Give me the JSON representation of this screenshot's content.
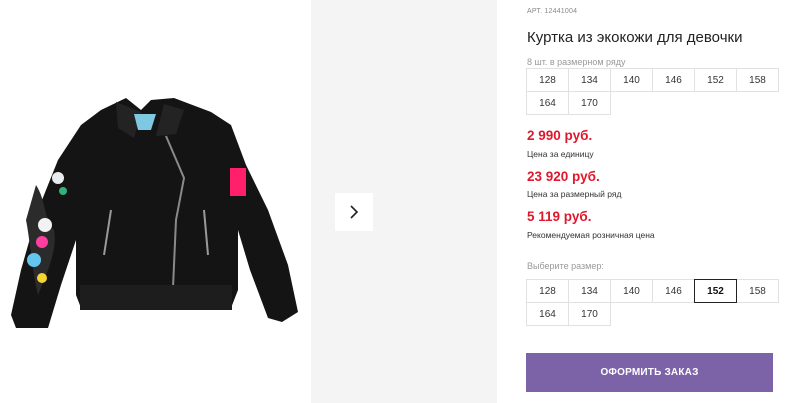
{
  "product": {
    "sku": "АРТ. 12441004",
    "title": "Куртка из экокожи для девочки",
    "image_icon": "jacket-image"
  },
  "pack": {
    "caption": "8 шт. в размерном ряду",
    "sizes": [
      "128",
      "134",
      "140",
      "146",
      "152",
      "158",
      "164",
      "170"
    ]
  },
  "prices": [
    {
      "value": "2 990 руб.",
      "label": "Цена за единицу"
    },
    {
      "value": "23 920 руб.",
      "label": "Цена за размерный ряд"
    },
    {
      "value": "5 119 руб.",
      "label": "Рекомендуемая розничная цена"
    }
  ],
  "size_select": {
    "caption": "Выберите размер:",
    "sizes": [
      "128",
      "134",
      "140",
      "146",
      "152",
      "158",
      "164",
      "170"
    ],
    "selected": "152"
  },
  "order_button": {
    "label": "ОФОРМИТЬ ЗАКАЗ"
  },
  "colors": {
    "price": "#e0182d",
    "accent": "#7c62a7"
  },
  "gallery": {
    "next_icon": "chevron-right-icon"
  }
}
